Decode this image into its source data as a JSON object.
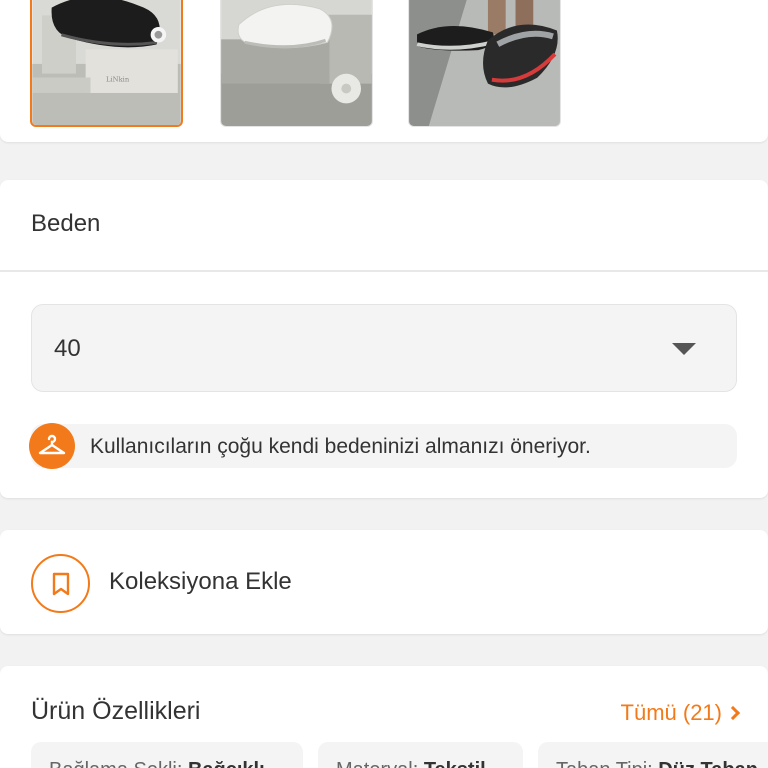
{
  "thumbnails": [
    {
      "alt": "black-sneaker",
      "selected": true
    },
    {
      "alt": "white-sneaker",
      "selected": false
    },
    {
      "alt": "black-grey-running-sneaker",
      "selected": false
    }
  ],
  "size": {
    "title": "Beden",
    "selected_value": "40",
    "hint": "Kullanıcıların çoğu kendi bedeninizi almanızı öneriyor."
  },
  "collection": {
    "label": "Koleksiyona Ekle"
  },
  "features": {
    "title": "Ürün Özellikleri",
    "all_label": "Tümü (21)",
    "chips": [
      {
        "key": "Bağlama Şekli: ",
        "value": "Bağcıklı"
      },
      {
        "key": "Materyal: ",
        "value": "Tekstil"
      },
      {
        "key": "Taban Tipi: ",
        "value": "Düz Taban"
      }
    ]
  },
  "colors": {
    "accent": "#f27a1a",
    "page_bg": "#f2f2f2"
  }
}
